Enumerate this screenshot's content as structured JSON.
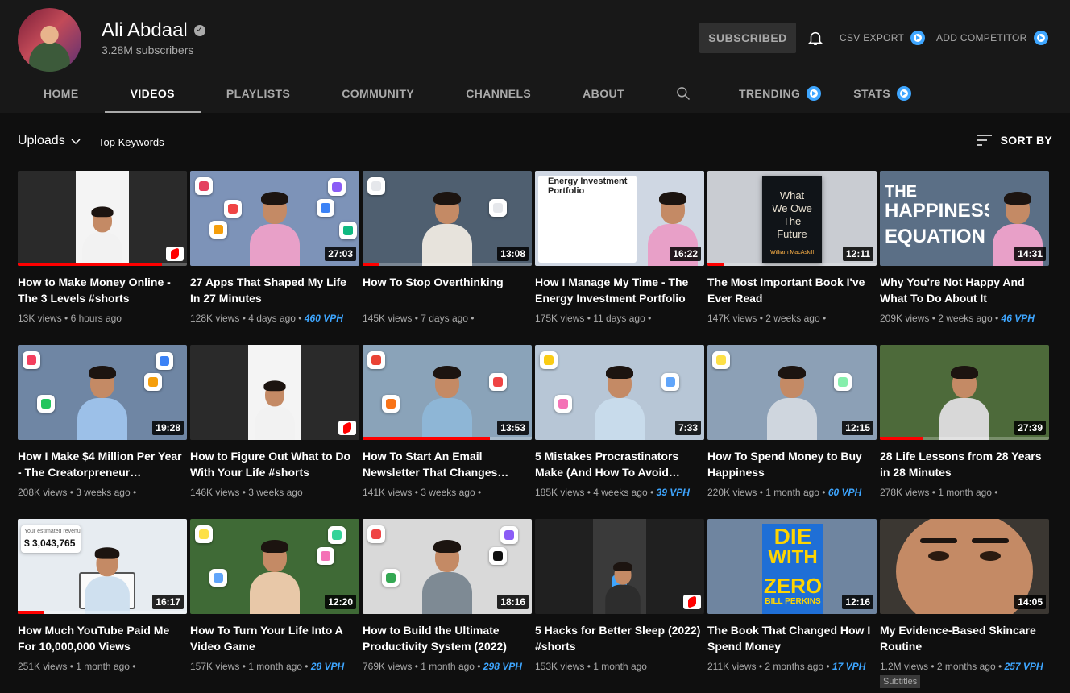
{
  "channel": {
    "name": "Ali Abdaal",
    "subscribers": "3.28M subscribers",
    "verified_icon": "verified-check-icon"
  },
  "header_actions": {
    "subscribe_label": "SUBSCRIBED",
    "csv_export_label": "CSV EXPORT",
    "add_competitor_label": "ADD COMPETITOR"
  },
  "tabs": [
    {
      "label": "HOME"
    },
    {
      "label": "VIDEOS"
    },
    {
      "label": "PLAYLISTS"
    },
    {
      "label": "COMMUNITY"
    },
    {
      "label": "CHANNELS"
    },
    {
      "label": "ABOUT"
    },
    {
      "label": "TRENDING"
    },
    {
      "label": "STATS"
    }
  ],
  "toolbar": {
    "uploads_label": "Uploads",
    "keywords_label": "Top Keywords",
    "sort_label": "SORT BY"
  },
  "videos": [
    {
      "title": "How to Make Money Online - The 3 Levels #shorts",
      "views": "13K views",
      "age": "6 hours ago",
      "vph": "",
      "duration": "",
      "shorts": true,
      "progress": 0.85,
      "theme": "#2a2a2a",
      "shirt": "#f2f2f2",
      "scene": "white"
    },
    {
      "title": "27 Apps That Shaped My Life In 27 Minutes",
      "views": "128K views",
      "age": "4 days ago",
      "vph": "460 VPH",
      "duration": "27:03",
      "shorts": false,
      "progress": 0.0,
      "theme": "#7d93b8",
      "shirt": "#e8a0c8",
      "scene": "apps"
    },
    {
      "title": "How To Stop Overthinking",
      "views": "145K views",
      "age": "7 days ago",
      "vph": "",
      "duration": "13:08",
      "shorts": false,
      "progress": 0.1,
      "theme": "#4f5f70",
      "shirt": "#e7e3dc",
      "scene": "sketch"
    },
    {
      "title": "How I Manage My Time - The Energy Investment Portfolio",
      "views": "175K views",
      "age": "11 days ago",
      "vph": "",
      "duration": "16:22",
      "shorts": false,
      "progress": 0.0,
      "theme": "#cfd7e3",
      "shirt": "#e8a0c8",
      "scene": "doc"
    },
    {
      "title": "The Most Important Book I've Ever Read",
      "views": "147K views",
      "age": "2 weeks ago",
      "vph": "",
      "duration": "12:11",
      "shorts": false,
      "progress": 0.1,
      "theme": "#c9ccd2",
      "shirt": "",
      "scene": "book"
    },
    {
      "title": "Why You're Not Happy And What To Do About It",
      "views": "209K views",
      "age": "2 weeks ago",
      "vph": "46 VPH",
      "duration": "14:31",
      "shorts": false,
      "progress": 0.0,
      "theme": "#5b6f86",
      "shirt": "#e8a0c8",
      "scene": "happy"
    },
    {
      "title": "How I Make $4 Million Per Year - The Creatorpreneur…",
      "views": "208K views",
      "age": "3 weeks ago",
      "vph": "",
      "duration": "19:28",
      "shorts": false,
      "progress": 0.0,
      "theme": "#6f86a4",
      "shirt": "#9cc0e8",
      "scene": "funnel"
    },
    {
      "title": "How to Figure Out What to Do With Your Life #shorts",
      "views": "146K views",
      "age": "3 weeks ago",
      "vph": "",
      "duration": "",
      "shorts": true,
      "progress": 0.0,
      "theme": "#2a2a2a",
      "shirt": "#f2f2f2",
      "scene": "white"
    },
    {
      "title": "How To Start An Email Newsletter That Changes…",
      "views": "141K views",
      "age": "3 weeks ago",
      "vph": "",
      "duration": "13:53",
      "shorts": false,
      "progress": 0.75,
      "theme": "#8aa3b9",
      "shirt": "#8eb6d6",
      "scene": "email"
    },
    {
      "title": "5 Mistakes Procrastinators Make (And How To Avoid…",
      "views": "185K views",
      "age": "4 weeks ago",
      "vph": "39 VPH",
      "duration": "7:33",
      "shorts": false,
      "progress": 0.0,
      "theme": "#b7c6d6",
      "shirt": "#c8dbeb",
      "scene": "procr"
    },
    {
      "title": "How To Spend Money to Buy Happiness",
      "views": "220K views",
      "age": "1 month ago",
      "vph": "60 VPH",
      "duration": "12:15",
      "shorts": false,
      "progress": 0.0,
      "theme": "#8ca0b6",
      "shirt": "#cfd6de",
      "scene": "money"
    },
    {
      "title": "28 Life Lessons from 28 Years in 28 Minutes",
      "views": "278K views",
      "age": "1 month ago",
      "vph": "",
      "duration": "27:39",
      "shorts": false,
      "progress": 0.25,
      "theme": "#4d6a3a",
      "shirt": "#d8d8d8",
      "scene": "garden"
    },
    {
      "title": "How Much YouTube Paid Me For 10,000,000 Views",
      "views": "251K views",
      "age": "1 month ago",
      "vph": "",
      "duration": "16:17",
      "shorts": false,
      "progress": 0.15,
      "theme": "#e7ecf1",
      "shirt": "#cfe0ef",
      "scene": "revenue"
    },
    {
      "title": "How To Turn Your Life Into A Video Game",
      "views": "157K views",
      "age": "1 month ago",
      "vph": "28 VPH",
      "duration": "12:20",
      "shorts": false,
      "progress": 0.0,
      "theme": "#3f6a36",
      "shirt": "#e8c8a8",
      "scene": "game"
    },
    {
      "title": "How to Build the Ultimate Productivity System (2022)",
      "views": "769K views",
      "age": "1 month ago",
      "vph": "298 VPH",
      "duration": "18:16",
      "shorts": false,
      "progress": 0.0,
      "theme": "#d9d9d9",
      "shirt": "#7e8a94",
      "scene": "prod"
    },
    {
      "title": "5 Hacks for Better Sleep (2022) #shorts",
      "views": "153K views",
      "age": "1 month ago",
      "vph": "",
      "duration": "",
      "shorts": true,
      "progress": 0.0,
      "theme": "#202020",
      "shirt": "#eeeeee",
      "scene": "dark"
    },
    {
      "title": "The Book That Changed How I Spend Money",
      "views": "211K views",
      "age": "2 months ago",
      "vph": "17 VPH",
      "duration": "12:16",
      "shorts": false,
      "progress": 0.0,
      "theme": "#6f85a0",
      "shirt": "",
      "scene": "die"
    },
    {
      "title": "My Evidence-Based Skincare Routine",
      "views": "1.2M views",
      "age": "2 months ago",
      "vph": "257 VPH",
      "duration": "14:05",
      "shorts": false,
      "progress": 0.0,
      "theme": "#3b3732",
      "shirt": "",
      "scene": "face"
    }
  ],
  "thumb_text": {
    "book": [
      "What",
      "We Owe",
      "The",
      "Future",
      "William MacAskill"
    ],
    "happy": [
      "THE",
      "HAPPINESS",
      "EQUATION"
    ],
    "doc": [
      "Energy Investment",
      "Portfolio"
    ],
    "revenue": [
      "Your estimated revenue",
      "$ 3,043,765"
    ],
    "die": [
      "DIE",
      "WITH",
      "ZERO",
      "BILL PERKINS"
    ]
  },
  "footer_chip": "Subtitles"
}
